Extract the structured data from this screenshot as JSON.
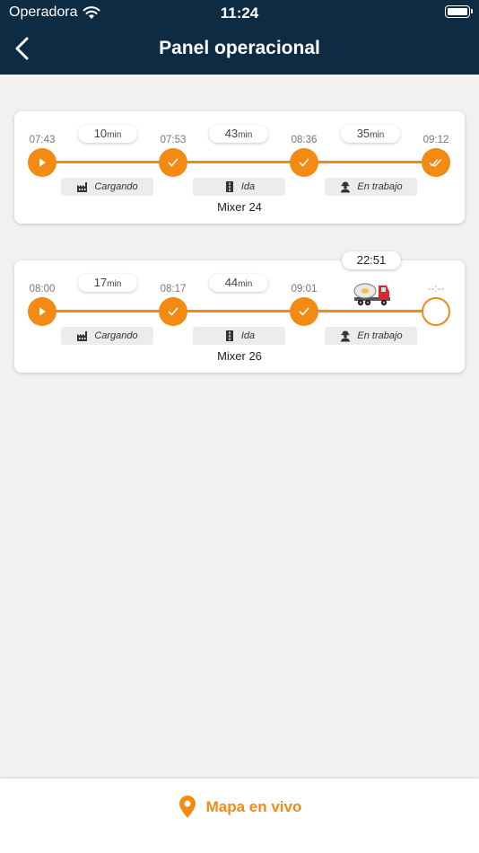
{
  "status_bar": {
    "carrier": "Operadora",
    "time": "11:24"
  },
  "header": {
    "title": "Panel operacional",
    "back_icon": "chevron-left-icon"
  },
  "colors": {
    "header_bg": "#0d2c44",
    "accent": "#f28a13",
    "background": "#f1f1f1"
  },
  "cards": [
    {
      "mixer": "Mixer 24",
      "times": [
        "07:43",
        "07:53",
        "08:36",
        "09:12"
      ],
      "durations": [
        {
          "value": "10",
          "unit": "min"
        },
        {
          "value": "43",
          "unit": "min"
        },
        {
          "value": "35",
          "unit": "min"
        }
      ],
      "phases": [
        "Cargando",
        "Ida",
        "En trabajo"
      ],
      "node_icons": [
        "play-icon",
        "check-icon",
        "check-icon",
        "double-check-icon"
      ]
    },
    {
      "mixer": "Mixer 26",
      "elapsed": "22:51",
      "times": [
        "08:00",
        "08:17",
        "09:01",
        "--:--"
      ],
      "durations": [
        {
          "value": "17",
          "unit": "min"
        },
        {
          "value": "44",
          "unit": "min"
        }
      ],
      "phases": [
        "Cargando",
        "Ida",
        "En trabajo"
      ],
      "node_icons": [
        "play-icon",
        "check-icon",
        "check-icon",
        "pending-icon"
      ]
    }
  ],
  "footer": {
    "map_label": "Mapa en vivo",
    "map_icon": "map-pin-icon"
  }
}
